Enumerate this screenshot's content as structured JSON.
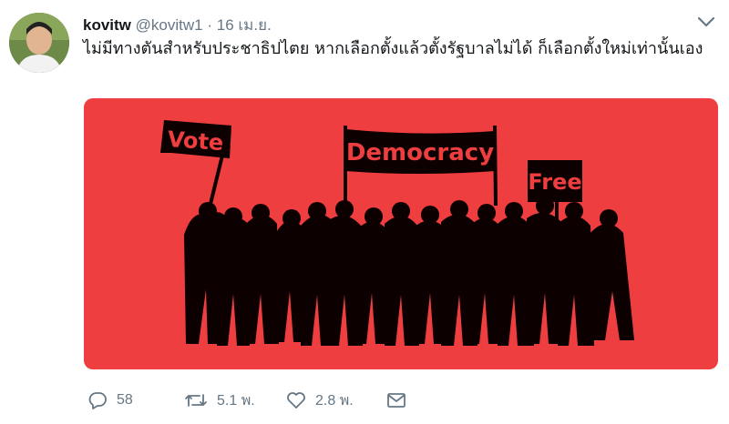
{
  "tweet": {
    "display_name": "kovitw",
    "handle": "@kovitw1",
    "separator": "·",
    "date": "16 เม.ย.",
    "text": "ไม่มีทางตันสำหรับประชาธิปไตย  หากเลือกตั้งแล้วตั้งรัฐบาลไม่ได้ ก็เลือกตั้งใหม่เท่านั้นเอง"
  },
  "media": {
    "background_color": "#ee3e3f",
    "signs": {
      "vote": "Vote",
      "democracy": "Democracy",
      "free": "Free"
    }
  },
  "actions": {
    "replies": "58",
    "retweets": "5.1 พ.",
    "likes": "2.8 พ."
  },
  "icons": [
    "chevron-down-icon",
    "reply-icon",
    "retweet-icon",
    "like-icon",
    "message-icon"
  ]
}
